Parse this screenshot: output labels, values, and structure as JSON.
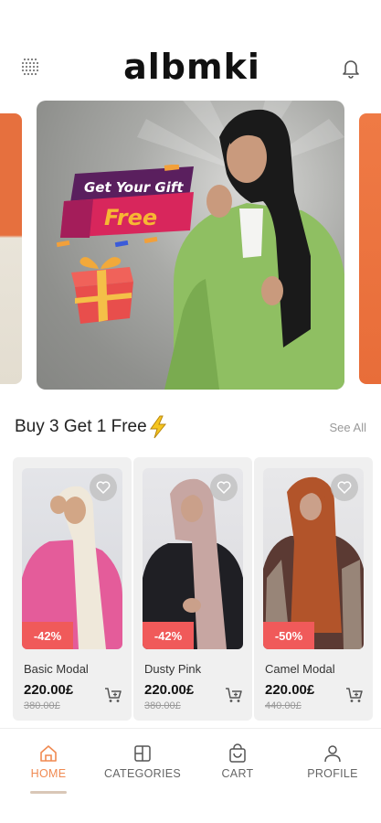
{
  "header": {
    "logo_text": "albmki",
    "menu_icon": "grid-dots-icon",
    "notification_icon": "bell-icon"
  },
  "banner": {
    "promo_line1": "Get Your Gift",
    "promo_line2": "Free"
  },
  "section": {
    "title": "Buy 3 Get 1 Free",
    "see_all": "See All",
    "icon": "lightning-bolt-icon"
  },
  "products": [
    {
      "name": "Basic Modal",
      "price": "220.00£",
      "old_price": "380.00£",
      "discount": "-42%"
    },
    {
      "name": "Dusty Pink",
      "price": "220.00£",
      "old_price": "380.00£",
      "discount": "-42%"
    },
    {
      "name": "Camel Modal",
      "price": "220.00£",
      "old_price": "440.00£",
      "discount": "-50%"
    }
  ],
  "nav": {
    "items": [
      {
        "label": "HOME",
        "icon": "home-icon",
        "active": true
      },
      {
        "label": "CATEGORIES",
        "icon": "categories-icon",
        "active": false
      },
      {
        "label": "CART",
        "icon": "cart-icon",
        "active": false
      },
      {
        "label": "PROFILE",
        "icon": "profile-icon",
        "active": false
      }
    ]
  },
  "colors": {
    "accent": "#f08a52",
    "discount": "#f05a5a",
    "banner_bg": "#8f908d"
  }
}
